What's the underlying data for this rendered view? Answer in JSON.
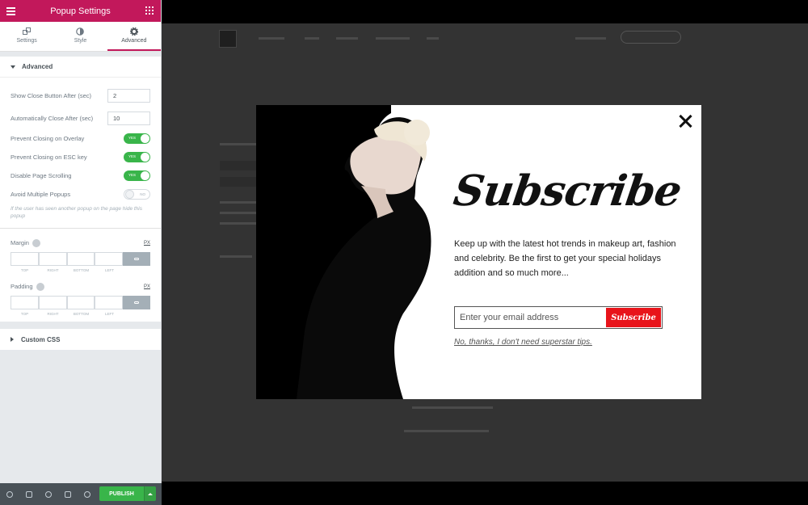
{
  "panel": {
    "title": "Popup Settings",
    "tabs": [
      {
        "label": "Settings"
      },
      {
        "label": "Style"
      },
      {
        "label": "Advanced"
      }
    ],
    "advanced_section": "Advanced",
    "controls": {
      "close_after_label": "Show Close Button After (sec)",
      "close_after_value": "2",
      "auto_close_label": "Automatically Close After (sec)",
      "auto_close_value": "10",
      "prevent_overlay_label": "Prevent Closing on Overlay",
      "prevent_overlay_state": "YES",
      "prevent_esc_label": "Prevent Closing on ESC key",
      "prevent_esc_state": "YES",
      "disable_scroll_label": "Disable Page Scrolling",
      "disable_scroll_state": "YES",
      "avoid_multiple_label": "Avoid Multiple Popups",
      "avoid_multiple_state": "NO",
      "avoid_multiple_note": "If the user has seen another popup on the page hide this popup"
    },
    "margin": {
      "label": "Margin",
      "unit": "PX",
      "caps": [
        "TOP",
        "RIGHT",
        "BOTTOM",
        "LEFT"
      ]
    },
    "padding": {
      "label": "Padding",
      "unit": "PX",
      "caps": [
        "TOP",
        "RIGHT",
        "BOTTOM",
        "LEFT"
      ]
    },
    "custom_css": "Custom CSS",
    "publish_label": "PUBLISH"
  },
  "popup": {
    "heading": "Subscribe",
    "description": "Keep up with the latest hot trends in makeup art, fashion and celebrity. Be the first to get your special holidays addition and so much more...",
    "email_placeholder": "Enter your email address",
    "button_label": "Subscribe",
    "decline_link": "No, thanks, I don't need superstar tips."
  },
  "colors": {
    "brand": "#c2185b",
    "toggle_on": "#39b54a",
    "subscribe_button": "#e8141b"
  }
}
